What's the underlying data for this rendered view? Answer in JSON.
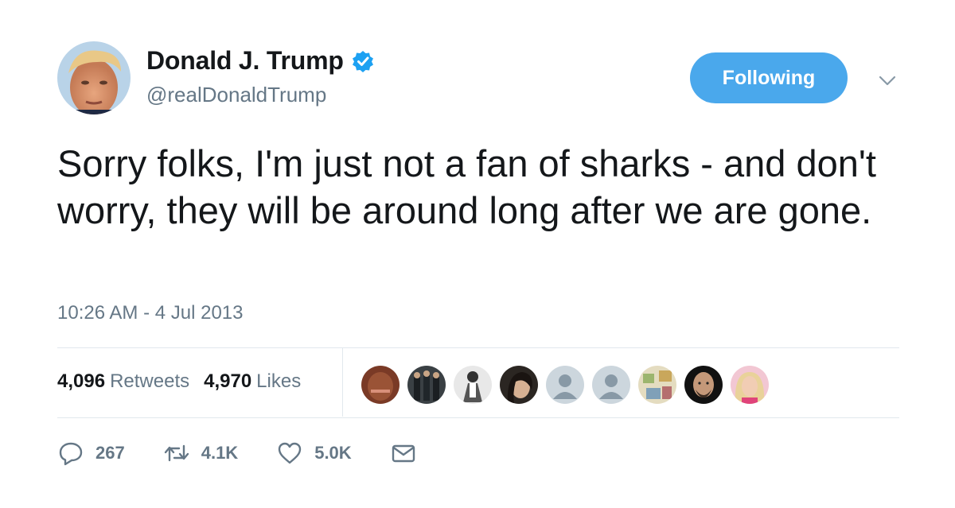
{
  "user": {
    "display_name": "Donald J. Trump",
    "handle": "@realDonaldTrump",
    "verified_icon": "verified-badge-icon"
  },
  "follow_button": {
    "label": "Following",
    "color": "#4aa8ec"
  },
  "tweet": {
    "text": "Sorry folks, I'm just not a fan of sharks - and don't worry, they will be around long after we are gone.",
    "timestamp": "10:26 AM - 4 Jul 2013"
  },
  "stats": {
    "retweets_count": "4,096",
    "retweets_label": "Retweets",
    "likes_count": "4,970",
    "likes_label": "Likes"
  },
  "liker_avatars": [
    {
      "name": "avatar-1"
    },
    {
      "name": "avatar-2"
    },
    {
      "name": "avatar-3"
    },
    {
      "name": "avatar-4"
    },
    {
      "name": "avatar-5"
    },
    {
      "name": "avatar-6"
    },
    {
      "name": "avatar-7"
    },
    {
      "name": "avatar-8"
    },
    {
      "name": "avatar-9"
    }
  ],
  "actions": {
    "reply_count": "267",
    "retweet_count": "4.1K",
    "like_count": "5.0K"
  },
  "colors": {
    "accent": "#1da1f2",
    "secondary_text": "#657786",
    "divider": "#e1e8ed"
  }
}
